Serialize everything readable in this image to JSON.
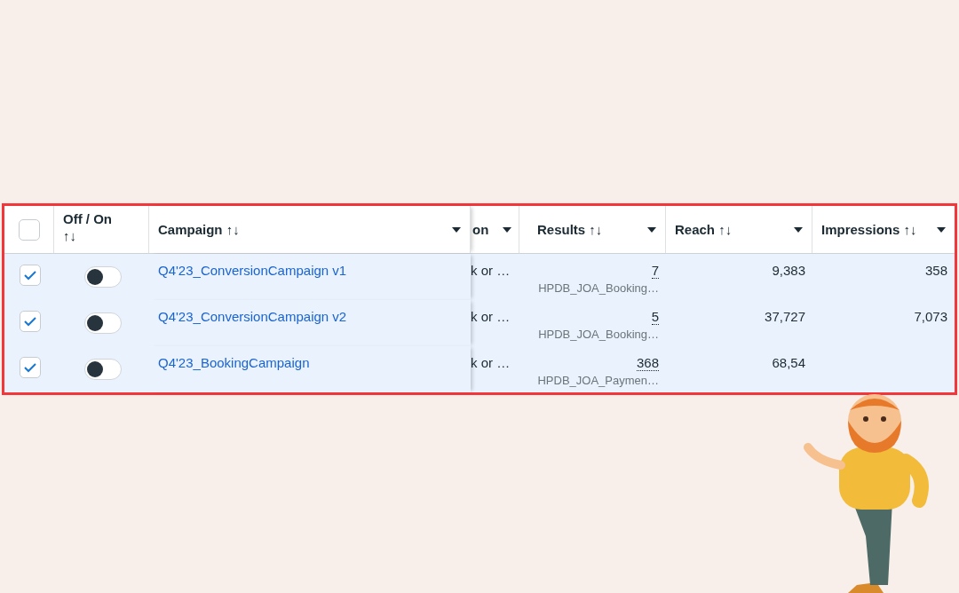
{
  "table": {
    "select_all": {
      "checked": false
    },
    "columns": [
      {
        "label": "Off / On",
        "sort_icon": "↑↓",
        "dropdown": false
      },
      {
        "label": "Campaign",
        "sort_icon": "↑↓",
        "dropdown": true
      },
      {
        "label": "on",
        "dropdown": true
      },
      {
        "label": "Results",
        "sort_icon": "↑↓",
        "dropdown": true
      },
      {
        "label": "Reach",
        "sort_icon": "↑↓",
        "dropdown": true
      },
      {
        "label": "Impressions",
        "sort_icon": "↑↓",
        "dropdown": true
      }
    ],
    "rows": [
      {
        "selected": true,
        "on": false,
        "campaign": "Q4'23_ConversionCampaign v1",
        "column_3": "k or …",
        "results": "7",
        "results_detail": "HPDB_JOA_Booking…",
        "reach": "9,383",
        "impressions": "358"
      },
      {
        "selected": true,
        "on": false,
        "campaign": "Q4'23_ConversionCampaign v2",
        "column_3": "k or …",
        "results": "5",
        "results_detail": "HPDB_JOA_Booking…",
        "reach": "37,727",
        "impressions": "7,073"
      },
      {
        "selected": true,
        "on": false,
        "campaign": "Q4'23_BookingCampaign",
        "column_3": "k or …",
        "results": "368",
        "results_detail": "HPDB_JOA_Paymen…",
        "reach": "68,54"
      }
    ]
  }
}
